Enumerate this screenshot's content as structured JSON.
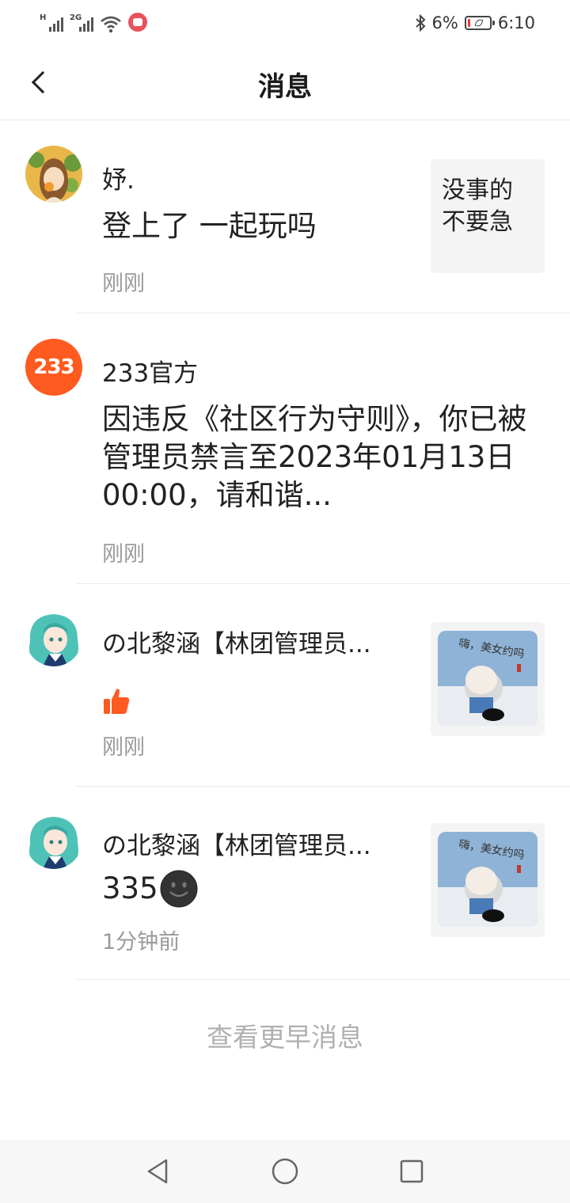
{
  "status_bar": {
    "signal1_tag": "H",
    "signal2_tag": "2G",
    "battery": "6%",
    "battery_level": 0.06,
    "time": "6:10",
    "icons": [
      "signal-icon",
      "wifi-icon",
      "app-notification-icon",
      "bluetooth-icon",
      "battery-icon"
    ]
  },
  "header": {
    "title": "消息",
    "back_icon": "chevron-left-icon"
  },
  "messages": [
    {
      "sender": "妤.",
      "content": "登上了 一起玩吗",
      "time": "刚刚",
      "quote": "没事的不要急"
    },
    {
      "sender": "233官方",
      "avatar_text": "233",
      "content": "因违反《社区行为守则》，你已被管理员禁言至2023年01月13日 00:00，请和谐...",
      "time": "刚刚"
    },
    {
      "sender": "の北黎涵【林团管理员...",
      "content_icon": "thumbs-up-icon",
      "time": "刚刚",
      "thumbnail_caption": "嗨，美女约吗"
    },
    {
      "sender": "の北黎涵【林团管理员...",
      "content": "335",
      "content_icon": "dark-face-emoji",
      "time": "1分钟前",
      "thumbnail_caption": "嗨，美女约吗"
    }
  ],
  "load_more": "查看更早消息",
  "colors": {
    "accent_orange": "#ff5a1f",
    "divider": "#ececec",
    "muted_text": "#9a9a9a",
    "load_more_text": "#b0b0b0"
  }
}
